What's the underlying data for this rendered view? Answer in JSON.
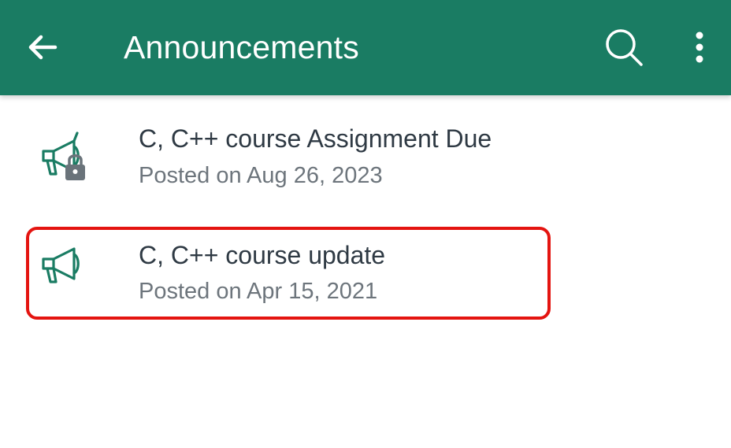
{
  "appbar": {
    "title": "Announcements",
    "back_icon": "arrow-left-icon",
    "search_icon": "search-icon",
    "more_icon": "more-vert-icon",
    "color": "#1a7c63"
  },
  "announcements": [
    {
      "title": "C, C++ course Assignment Due",
      "posted": "Posted on Aug 26, 2023",
      "icon": "megaphone-locked-icon"
    },
    {
      "title": "C, C++ course update",
      "posted": "Posted on Apr 15, 2021",
      "icon": "megaphone-icon"
    }
  ],
  "highlight_color": "#e41410"
}
